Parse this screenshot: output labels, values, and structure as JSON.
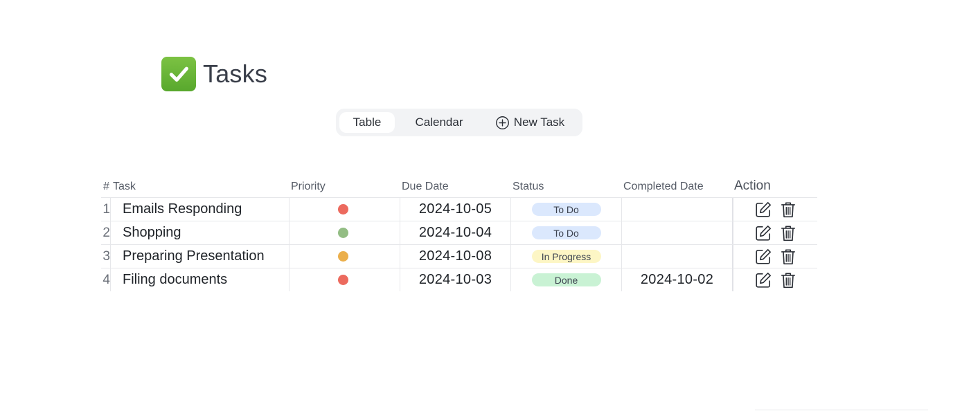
{
  "header": {
    "title": "Tasks",
    "logo_icon": "check-mark-icon",
    "logo_color": "#6ab437"
  },
  "nav": {
    "tabs": [
      {
        "label": "Table",
        "active": true
      },
      {
        "label": "Calendar",
        "active": false
      }
    ],
    "new_task_label": "New Task",
    "new_task_icon": "plus-circle-icon"
  },
  "table": {
    "columns": {
      "num": "#",
      "task": "Task",
      "priority": "Priority",
      "due_date": "Due Date",
      "status": "Status",
      "completed_date": "Completed Date",
      "action": "Action"
    },
    "rows": [
      {
        "num": "1",
        "task": "Emails Responding",
        "priority_color": "#ec6a5e",
        "due_date": "2024-10-05",
        "status": "To Do",
        "status_color": "#dbe8fd",
        "completed_date": ""
      },
      {
        "num": "2",
        "task": "Shopping",
        "priority_color": "#93bd84",
        "due_date": "2024-10-04",
        "status": "To Do",
        "status_color": "#dbe8fd",
        "completed_date": ""
      },
      {
        "num": "3",
        "task": "Preparing Presentation",
        "priority_color": "#ebaf4c",
        "due_date": "2024-10-08",
        "status": "In Progress",
        "status_color": "#fdf6c5",
        "completed_date": ""
      },
      {
        "num": "4",
        "task": "Filing documents",
        "priority_color": "#ec6a5e",
        "due_date": "2024-10-03",
        "status": "Done",
        "status_color": "#c9f2d4",
        "completed_date": "2024-10-02"
      }
    ],
    "action_icons": [
      "edit-icon",
      "trash-icon"
    ]
  }
}
